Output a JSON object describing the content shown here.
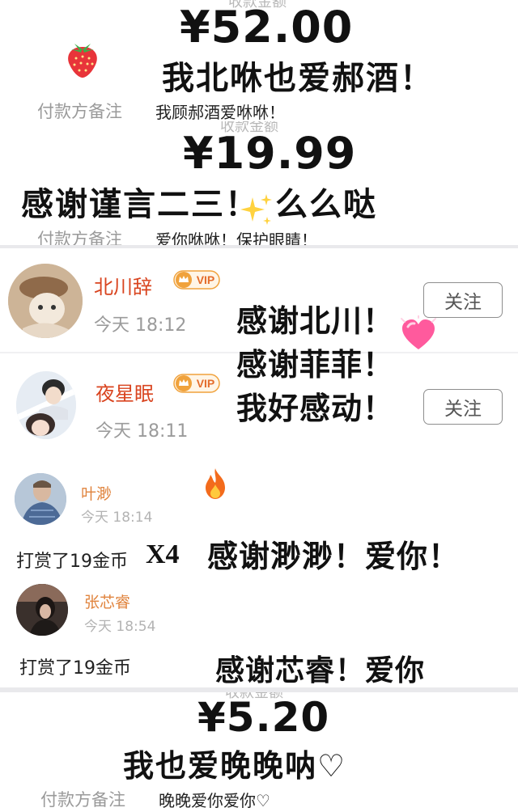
{
  "payments": [
    {
      "amount": "¥52.00",
      "caption": "我北咻也爱郝酒！",
      "remark_label": "付款方备注",
      "remark_value": "我顾郝酒爱咻咻！",
      "icon": "strawberry-icon"
    },
    {
      "amount": "¥19.99",
      "caption_before": "感谢谨言二三！",
      "caption_after": "么么哒",
      "remark_label": "付款方备注",
      "remark_value": "爱你咻咻！保护眼睛！",
      "icon": "sparkles-icon"
    },
    {
      "amount": "¥5.20",
      "caption": "我也爱晚晚呐♡",
      "remark_label": "付款方备注",
      "remark_value": "晚晚爱你爱你♡"
    }
  ],
  "followers": [
    {
      "name": "北川辞",
      "badge": "VIP",
      "time": "今天 18:12",
      "follow_label": "关注"
    },
    {
      "name": "夜星眠",
      "badge": "VIP",
      "time": "今天 18:11",
      "follow_label": "关注"
    }
  ],
  "follower_thanks": [
    "感谢北川！",
    "感谢菲菲！",
    "我好感动！"
  ],
  "gifts": [
    {
      "name": "叶渺",
      "time": "今天 18:14",
      "reward": "打赏了19金币",
      "multiplier": "X4",
      "thanks": "感谢渺渺！爱你！",
      "icon": "fire-icon"
    },
    {
      "name": "张芯睿",
      "time": "今天 18:54",
      "reward": "打赏了19金币",
      "thanks": "感谢芯睿！爱你"
    }
  ],
  "colors": {
    "name_red": "#d9441f",
    "name_orange": "#e0843e",
    "vip_gold": "#f0a23c",
    "divider": "#e9e9ec"
  }
}
